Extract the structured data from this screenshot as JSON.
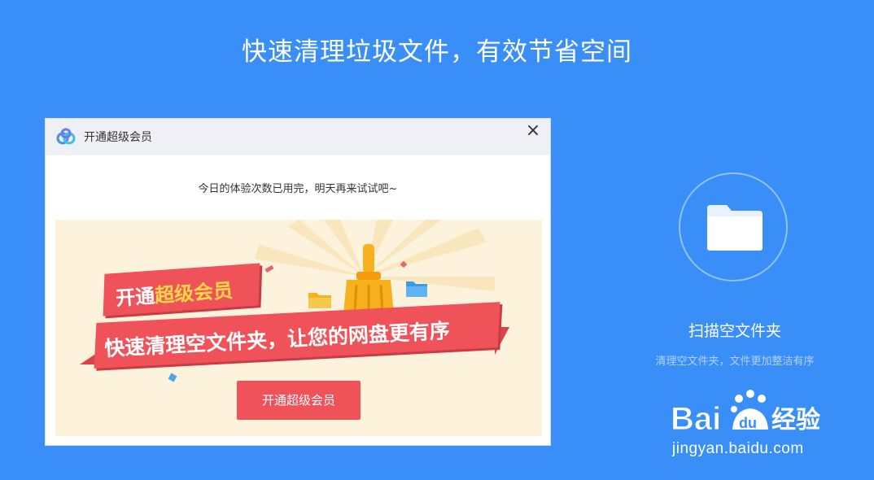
{
  "headline": "快速清理垃圾文件，有效节省空间",
  "dialog": {
    "title": "开通超级会员",
    "close_icon": "×",
    "notice": "今日的体验次数已用完，明天再来试试吧~",
    "banner": {
      "ribbon1_prefix": "开通",
      "ribbon1_highlight": "超级会员",
      "ribbon2": "快速清理空文件夹，让您的网盘更有序"
    },
    "cta_label": "开通超级会员"
  },
  "feature": {
    "icon": "folder-icon",
    "title": "扫描空文件夹",
    "subtitle": "清理空文件夹，文件更加整洁有序"
  },
  "watermark": {
    "brand": "Bai du 经验",
    "url": "jingyan.baidu.com"
  },
  "colors": {
    "background": "#3a8ef8",
    "accent_red": "#f0525a",
    "highlight_yellow": "#ffd84a",
    "banner_bg": "#fdf3dc"
  }
}
